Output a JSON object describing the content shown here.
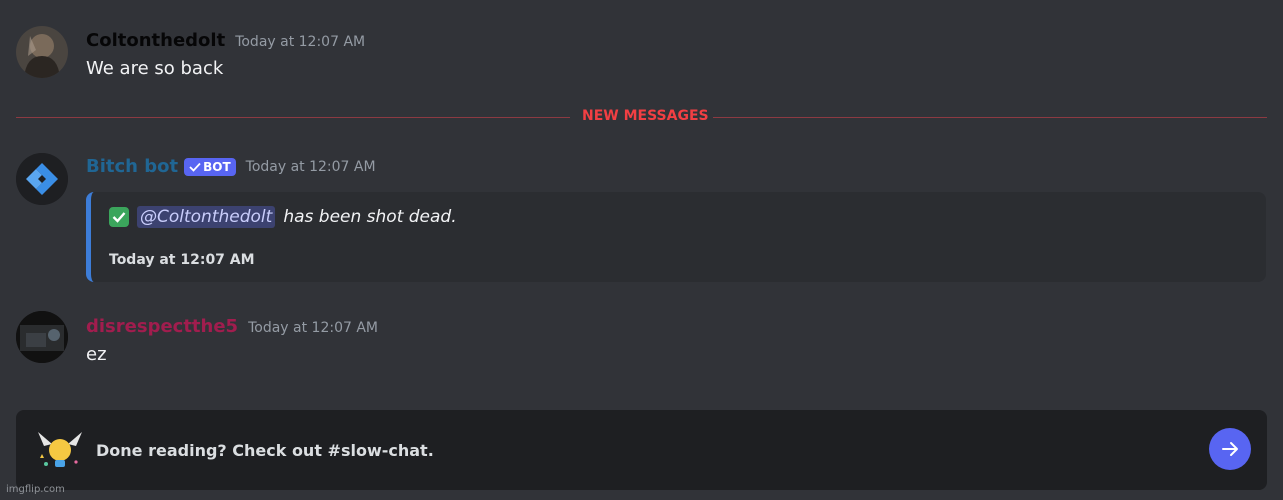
{
  "messages": [
    {
      "username": "Coltonthedolt",
      "timestamp": "Today at 12:07 AM",
      "content": "We are so back"
    },
    {
      "username": "Bitch bot",
      "bot_tag": "BOT",
      "timestamp": "Today at 12:07 AM",
      "embed": {
        "mention": "@Coltonthedolt",
        "text": "has been shot dead.",
        "footer_time": "Today at 12:07 AM"
      }
    },
    {
      "username": "disrespectthe5",
      "timestamp": "Today at 12:07 AM",
      "content": "ez"
    }
  ],
  "divider": {
    "label": "NEW MESSAGES"
  },
  "footer": {
    "text": "Done reading? Check out #slow-chat."
  },
  "watermark": "imgflip.com",
  "colors": {
    "background": "#313338",
    "accent": "#5865f2",
    "new_messages": "#f23f43",
    "bot_name": "#206694",
    "user3_name": "#a11d4e"
  },
  "icons": [
    "avatar",
    "bot-avatar-icon",
    "checkmark-icon",
    "lightbulb-icon",
    "arrow-right-icon"
  ]
}
